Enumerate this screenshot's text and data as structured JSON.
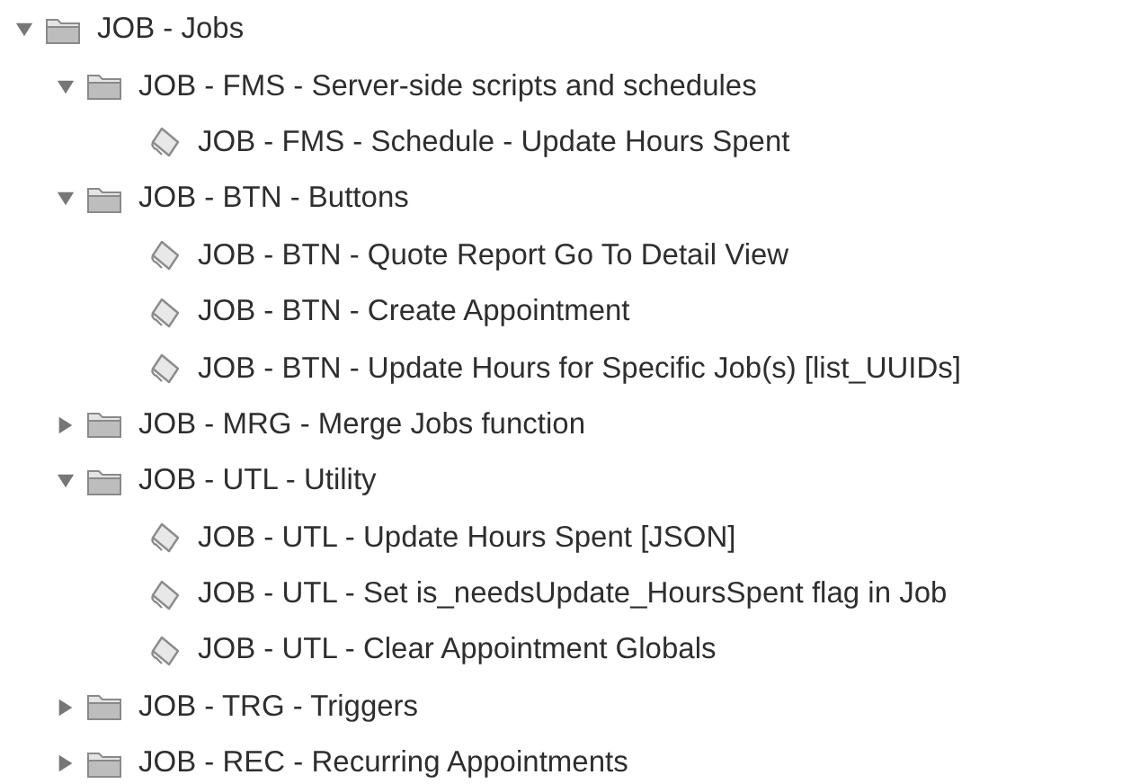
{
  "tree": [
    {
      "kind": "folder",
      "label": "JOB - Jobs",
      "expanded": true,
      "children": [
        {
          "kind": "folder",
          "label": "JOB - FMS - Server-side scripts and schedules",
          "expanded": true,
          "children": [
            {
              "kind": "script",
              "label": "JOB - FMS - Schedule - Update Hours Spent"
            }
          ]
        },
        {
          "kind": "folder",
          "label": "JOB - BTN - Buttons",
          "expanded": true,
          "children": [
            {
              "kind": "script",
              "label": "JOB - BTN - Quote Report Go To Detail View"
            },
            {
              "kind": "script",
              "label": "JOB - BTN - Create Appointment"
            },
            {
              "kind": "script",
              "label": "JOB - BTN - Update Hours for Specific Job(s) [list_UUIDs]"
            }
          ]
        },
        {
          "kind": "folder",
          "label": "JOB - MRG - Merge Jobs function",
          "expanded": false
        },
        {
          "kind": "folder",
          "label": "JOB - UTL - Utility",
          "expanded": true,
          "children": [
            {
              "kind": "script",
              "label": "JOB - UTL - Update Hours Spent [JSON]"
            },
            {
              "kind": "script",
              "label": "JOB - UTL - Set is_needsUpdate_HoursSpent flag in Job"
            },
            {
              "kind": "script",
              "label": "JOB - UTL - Clear Appointment Globals"
            }
          ]
        },
        {
          "kind": "folder",
          "label": "JOB - TRG - Triggers",
          "expanded": false
        },
        {
          "kind": "folder",
          "label": "JOB - REC - Recurring Appointments",
          "expanded": false
        }
      ]
    }
  ]
}
